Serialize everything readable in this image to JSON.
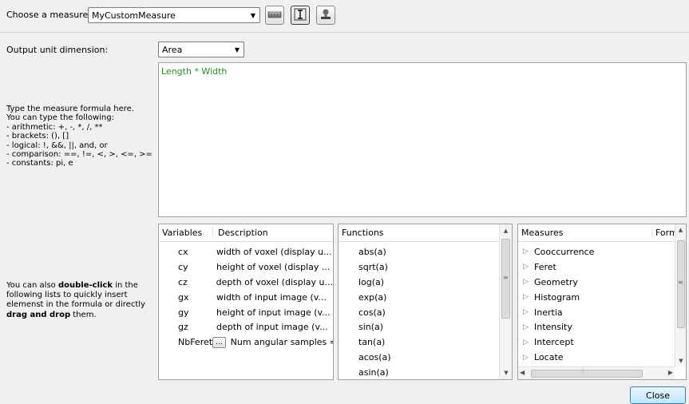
{
  "measure": {
    "label": "Choose a measure:",
    "selected": "MyCustomMeasure"
  },
  "toolbar": {
    "icons": [
      "ruler-icon",
      "text-cursor-icon",
      "stamp-icon"
    ]
  },
  "output": {
    "label": "Output unit dimension:",
    "selected": "Area"
  },
  "formula": {
    "text": "Length * Width",
    "text_color": "#2e8b2e"
  },
  "help_formula": [
    "Type the measure formula here.",
    "You can type the following:",
    "- arithmetic: +, -, *, /, **",
    "- brackets: (), []",
    "- logical: !, &&, ||, and, or",
    "- comparison: ==, !=, <, >, <=, >=",
    "- constants: pi, e"
  ],
  "help_lists": {
    "pre": "You can also ",
    "bold1": "double-click",
    "mid1": " in the",
    "line2": "following lists to quickly insert",
    "line3": "elemenst in the formula or directly",
    "bold2": "drag and drop",
    "post": " them."
  },
  "variables": {
    "headers": [
      "Variables",
      "Description"
    ],
    "rows": [
      {
        "name": "cx",
        "desc": "width of voxel (display u..."
      },
      {
        "name": "cy",
        "desc": "height of voxel (display ..."
      },
      {
        "name": "cz",
        "desc": "depth of voxel (display u..."
      },
      {
        "name": "gx",
        "desc": "width of input image (v..."
      },
      {
        "name": "gy",
        "desc": "height of input image (v..."
      },
      {
        "name": "gz",
        "desc": "depth of input image (v..."
      }
    ],
    "nbferet": {
      "name": "NbFeret",
      "button": "...",
      "desc": "Num angular samples ="
    }
  },
  "functions": {
    "header": "Functions",
    "items": [
      "abs(a)",
      "sqrt(a)",
      "log(a)",
      "exp(a)",
      "cos(a)",
      "sin(a)",
      "tan(a)",
      "acos(a)",
      "asin(a)"
    ]
  },
  "measures": {
    "headers": [
      "Measures",
      "Form"
    ],
    "items": [
      "Cooccurrence",
      "Feret",
      "Geometry",
      "Histogram",
      "Inertia",
      "Intensity",
      "Intercept",
      "Locate"
    ]
  },
  "close": {
    "label": "Close"
  },
  "colors": {
    "accent": "#3c7fb1",
    "background": "#f0f0f0"
  }
}
